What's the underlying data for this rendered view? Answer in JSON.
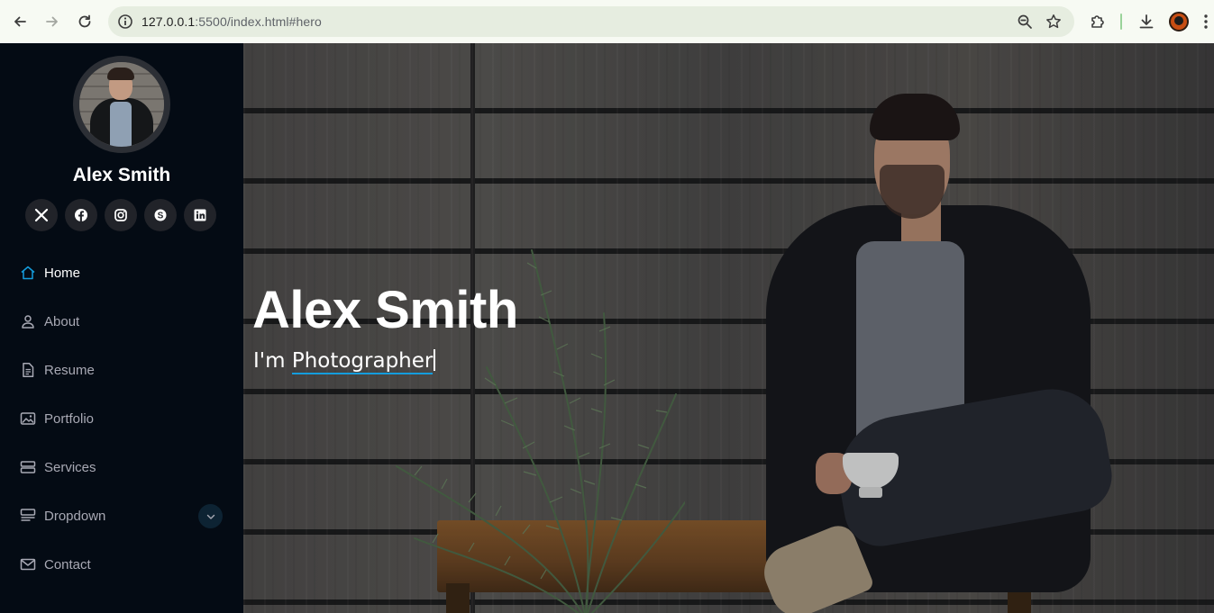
{
  "browser": {
    "url_host": "127.0.0.1",
    "url_rest": ":5500/index.html#hero"
  },
  "sidebar": {
    "profile_name": "Alex Smith",
    "socials": [
      "x-twitter-icon",
      "facebook-icon",
      "instagram-icon",
      "skype-icon",
      "linkedin-icon"
    ],
    "menu": [
      {
        "label": "Home",
        "icon": "house-icon",
        "active": true
      },
      {
        "label": "About",
        "icon": "person-icon",
        "active": false
      },
      {
        "label": "Resume",
        "icon": "document-icon",
        "active": false
      },
      {
        "label": "Portfolio",
        "icon": "images-icon",
        "active": false
      },
      {
        "label": "Services",
        "icon": "hdd-stack-icon",
        "active": false
      },
      {
        "label": "Dropdown",
        "icon": "menu-button-icon",
        "active": false
      },
      {
        "label": "Contact",
        "icon": "envelope-icon",
        "active": false
      }
    ]
  },
  "hero": {
    "title": "Alex Smith",
    "prefix": "I'm ",
    "typed": "Photographer"
  },
  "colors": {
    "accent": "#149ddd",
    "sidebar_bg": "#040b14",
    "menu_text": "#a8a9b4"
  }
}
